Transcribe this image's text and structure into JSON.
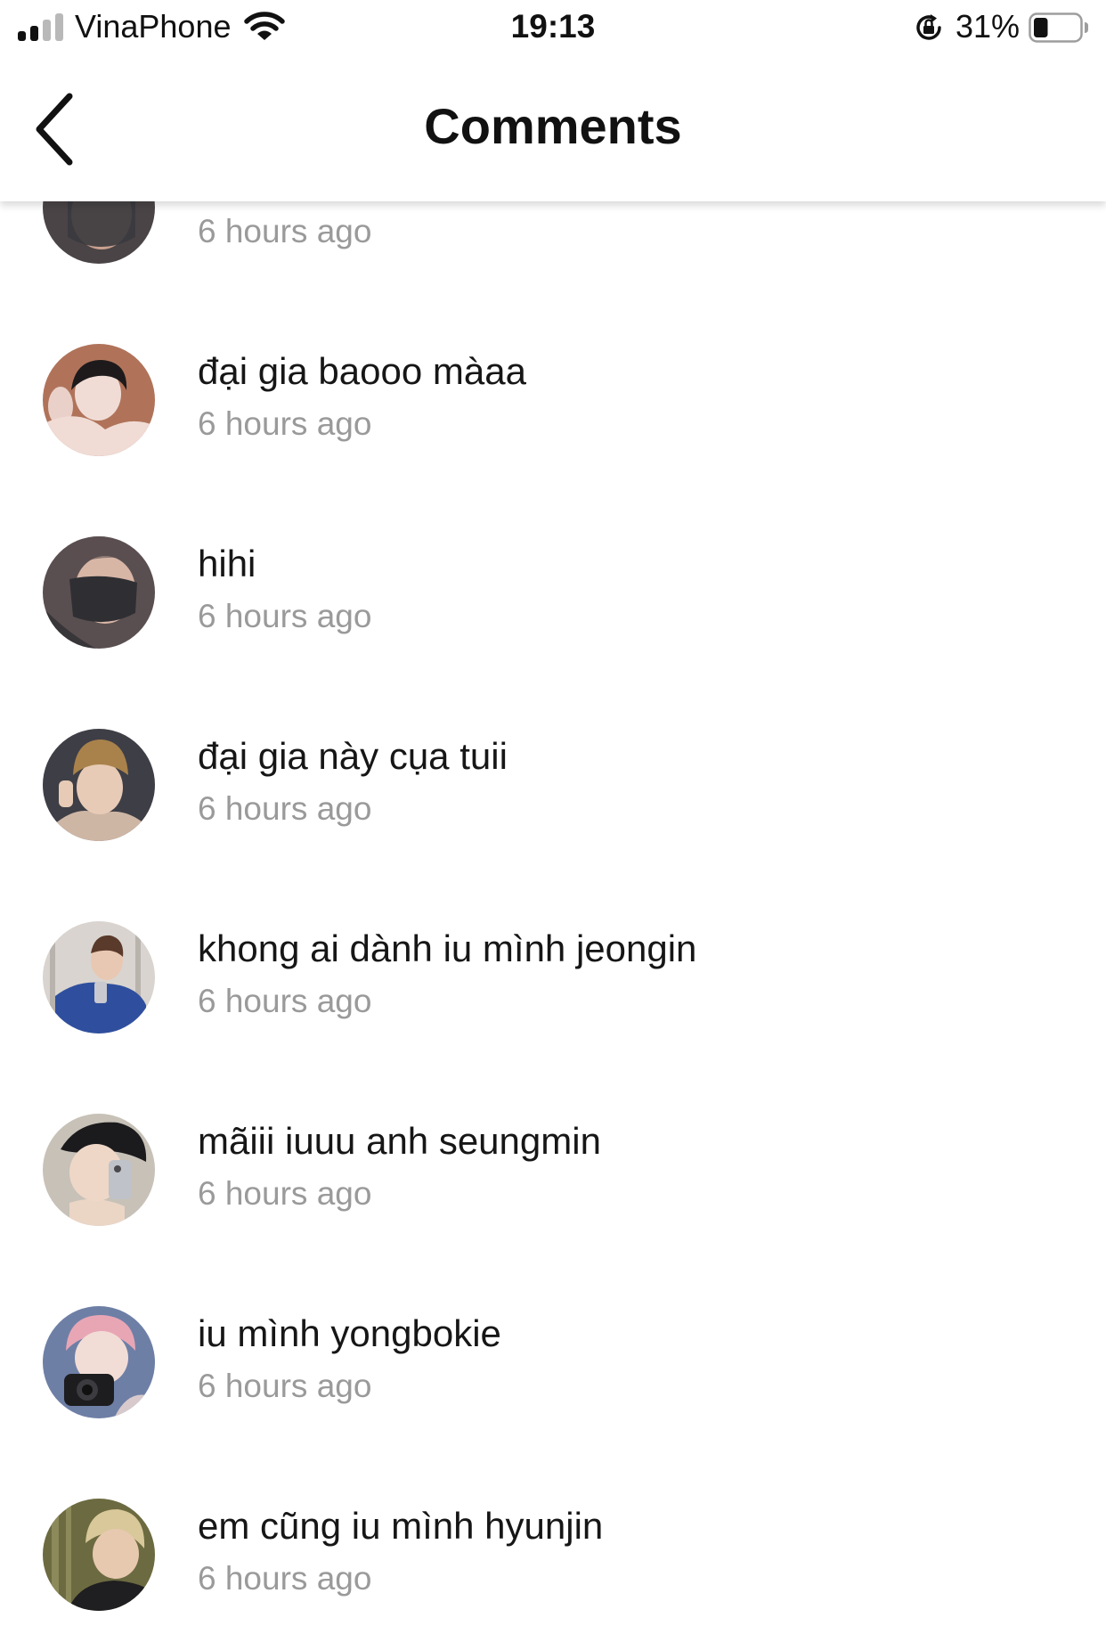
{
  "status_bar": {
    "carrier": "VinaPhone",
    "time": "19:13",
    "battery_percent": "31%",
    "battery_level": 0.31,
    "signal_bars_active": 2,
    "signal_bars_total": 4
  },
  "header": {
    "title": "Comments",
    "back_icon": "chevron-left-icon"
  },
  "comments": [
    {
      "text": "",
      "time": "6 hours ago",
      "avatar": {
        "bg": "#4a4446",
        "accent": "#3a3a3e",
        "skin": "#c9a08f"
      }
    },
    {
      "text": "đại gia baooo màaa",
      "time": "6 hours ago",
      "avatar": {
        "bg": "#b0735a",
        "accent": "#1e1a1c",
        "skin": "#f0dcd5"
      }
    },
    {
      "text": "hihi",
      "time": "6 hours ago",
      "avatar": {
        "bg": "#5a4f50",
        "accent": "#2f2f33",
        "skin": "#d8b6a6"
      }
    },
    {
      "text": "đại gia này cụa tuii",
      "time": "6 hours ago",
      "avatar": {
        "bg": "#3e3e46",
        "accent": "#a9824b",
        "skin": "#e7cbb6"
      }
    },
    {
      "text": "khong ai dành iu mình jeongin",
      "time": "6 hours ago",
      "avatar": {
        "bg": "#d9d4cf",
        "accent": "#2f4f9e",
        "skin": "#e8c8b2"
      }
    },
    {
      "text": "mãiii iuuu anh seungmin",
      "time": "6 hours ago",
      "avatar": {
        "bg": "#c7c1b8",
        "accent": "#1b1b1d",
        "skin": "#eed7c7"
      }
    },
    {
      "text": "iu mình yongbokie",
      "time": "6 hours ago",
      "avatar": {
        "bg": "#6e7fa6",
        "accent": "#e8a6b5",
        "skin": "#f2ddd6"
      }
    },
    {
      "text": "em cũng iu mình hyunjin",
      "time": "6 hours ago",
      "avatar": {
        "bg": "#6c6a40",
        "accent": "#d8c89a",
        "skin": "#e7c9b0"
      }
    }
  ]
}
